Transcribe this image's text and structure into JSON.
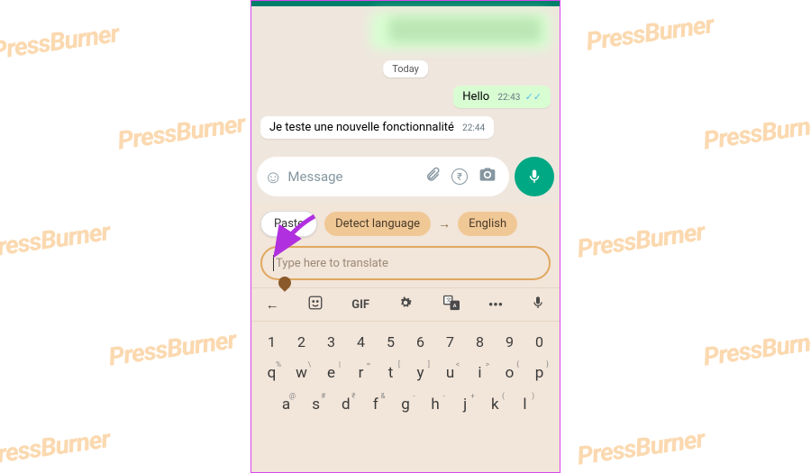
{
  "watermark": "PressBurner",
  "chat": {
    "date_label": "Today",
    "outgoing": {
      "text": "Hello",
      "time": "22:43"
    },
    "incoming": {
      "text": "Je teste une nouvelle fonctionnalité",
      "time": "22:44"
    }
  },
  "composer": {
    "placeholder": "Message"
  },
  "translate": {
    "paste": "Paste",
    "source": "Detect language",
    "target": "English",
    "placeholder": "Type here to translate"
  },
  "toolbar": {
    "gif": "GIF"
  },
  "keyboard": {
    "numbers": [
      "1",
      "2",
      "3",
      "4",
      "5",
      "6",
      "7",
      "8",
      "9",
      "0"
    ],
    "row1": [
      "q",
      "w",
      "e",
      "r",
      "t",
      "y",
      "u",
      "i",
      "o",
      "p"
    ],
    "row1_sup": [
      "%",
      "\\",
      "|",
      "=",
      "[",
      "]",
      "<",
      ">",
      "{",
      "}"
    ],
    "row2": [
      "a",
      "s",
      "d",
      "f",
      "g",
      "h",
      "j",
      "k",
      "l"
    ],
    "row2_sup": [
      "@",
      "#",
      "₹",
      "&",
      "-",
      "-",
      "+",
      "(",
      ")"
    ]
  }
}
